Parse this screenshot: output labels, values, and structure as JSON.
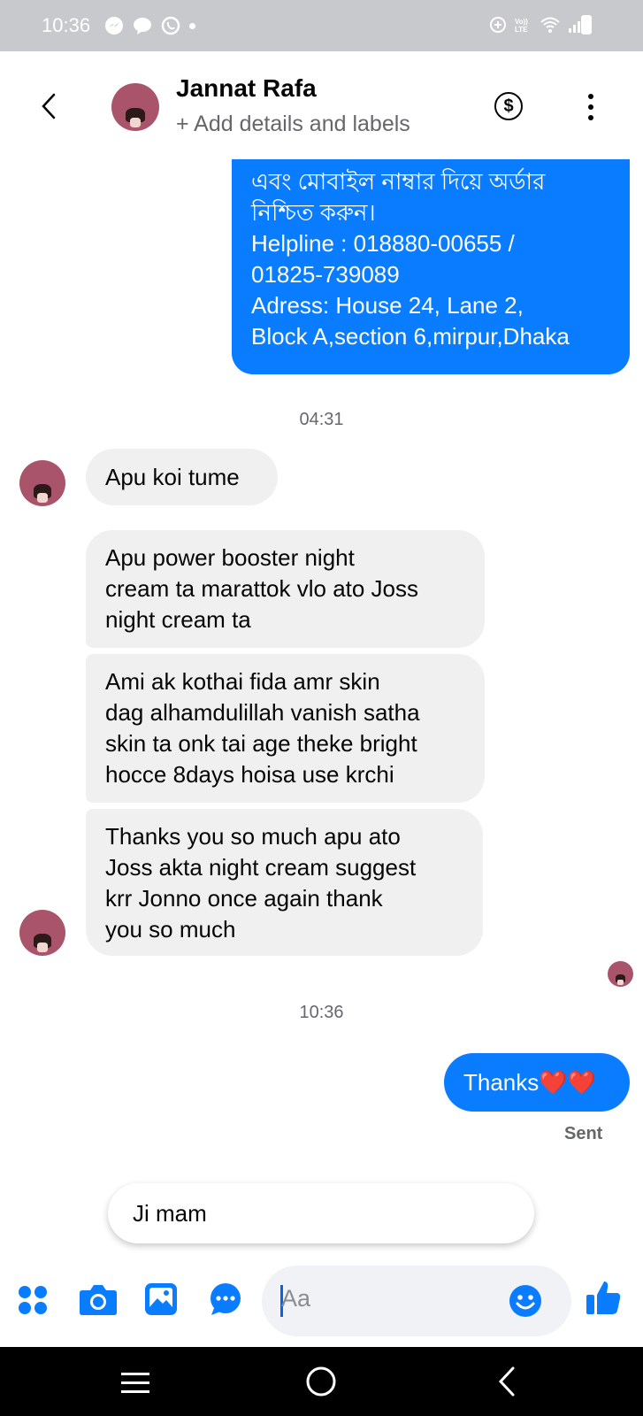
{
  "status_bar": {
    "time": "10:36"
  },
  "header": {
    "contact_name": "Jannat Rafa",
    "subtitle": "+ Add details and labels",
    "dollar_symbol": "$"
  },
  "messages": {
    "outgoing_block": {
      "lines": [
        "এবং মোবাইল নাম্বার দিয়ে অর্ডার",
        "নিশ্চিত করুন।",
        "Helpline : 018880-00655 /",
        "01825-739089",
        "Adress: House 24, Lane 2,",
        "Block A,section 6,mirpur,Dhaka"
      ]
    },
    "time_1": "04:31",
    "incoming_1": "Apu koi tume",
    "incoming_2": {
      "lines": [
        "Apu power booster night",
        "cream ta marattok vlo ato Joss",
        "night cream ta"
      ]
    },
    "incoming_3": {
      "lines": [
        "Ami ak kothai fida amr skin",
        "dag alhamdulillah vanish satha",
        "skin ta onk tai age theke bright",
        "hocce 8days hoisa use krchi"
      ]
    },
    "incoming_4": {
      "lines": [
        "Thanks you so much apu ato",
        "Joss akta night cream suggest",
        "krr Jonno once again thank",
        "you so much"
      ]
    },
    "time_2": "10:36",
    "outgoing_last": "Thanks❤️❤️",
    "sent_status": "Sent"
  },
  "quick_reply": "Ji mam",
  "composer": {
    "placeholder": "Aa"
  },
  "colors": {
    "outgoing_bubble": "#0a7cff",
    "incoming_bubble": "#f0f0f0",
    "accent": "#0a7cff"
  },
  "icons": [
    "back-icon",
    "dollar-icon",
    "more-icon",
    "apps-icon",
    "camera-icon",
    "gallery-icon",
    "chat-icon",
    "emoji-icon",
    "like-icon"
  ]
}
